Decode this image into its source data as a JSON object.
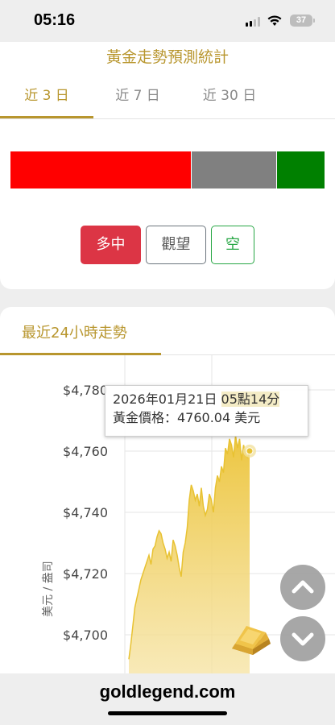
{
  "status_bar": {
    "time": "05:16",
    "battery": "37"
  },
  "forecast": {
    "title": "黃金走勢預測統計",
    "tabs": [
      {
        "label": "近 3 日",
        "active": true
      },
      {
        "label": "近 7 日",
        "active": false
      },
      {
        "label": "近 30 日",
        "active": false
      }
    ],
    "sentiment_bar": {
      "long_share": 0.56,
      "wait_share": 0.26,
      "short_share": 0.15,
      "colors": {
        "long": "#ff0000",
        "wait": "#808080",
        "short": "#008000"
      }
    },
    "buttons": {
      "long": "多中",
      "wait": "觀望",
      "short": "空"
    }
  },
  "trend": {
    "title": "最近24小時走勢",
    "tooltip": {
      "date_prefix": "2026年01月21日",
      "time_part": "05點14分",
      "price_label": "黃金價格：4760.04 美元"
    }
  },
  "chart_data": {
    "type": "area",
    "title": "",
    "xlabel": "",
    "ylabel": "美元 / 盎司",
    "y_ticks": [
      "$4,780",
      "$4,760",
      "$4,740",
      "$4,720",
      "$4,700"
    ],
    "ylim": [
      4690,
      4781
    ],
    "grid": true,
    "color": "#e8c232",
    "series": [
      {
        "x": [
          0,
          1,
          2,
          3,
          4,
          5,
          6,
          7,
          8,
          9,
          10,
          11,
          12,
          13,
          14,
          15,
          16,
          17,
          18,
          19,
          20,
          21,
          22,
          23,
          24,
          25,
          26,
          27,
          28,
          29,
          30,
          31,
          32,
          33,
          34,
          35,
          36,
          37,
          38,
          39,
          40,
          41,
          42,
          43,
          44,
          45,
          46,
          47,
          48,
          49,
          50,
          51,
          52,
          53,
          54,
          55,
          56,
          57,
          58,
          59,
          60
        ],
        "values": [
          4692,
          4697,
          4703,
          4709,
          4712,
          4715,
          4718,
          4720,
          4722,
          4724,
          4726,
          4723,
          4728,
          4729,
          4732,
          4734,
          4733,
          4730,
          4728,
          4725,
          4727,
          4724,
          4731,
          4729,
          4726,
          4722,
          4719,
          4727,
          4730,
          4735,
          4744,
          4749,
          4747,
          4744,
          4746,
          4742,
          4748,
          4742,
          4739,
          4741,
          4746,
          4744,
          4740,
          4748,
          4752,
          4750,
          4755,
          4753,
          4761,
          4759,
          4764,
          4762,
          4758,
          4765,
          4761,
          4764,
          4757,
          4762,
          4759,
          4758,
          4760.04
        ]
      }
    ],
    "last_point": 4760.04
  },
  "footer": {
    "site": "goldlegend.com"
  }
}
